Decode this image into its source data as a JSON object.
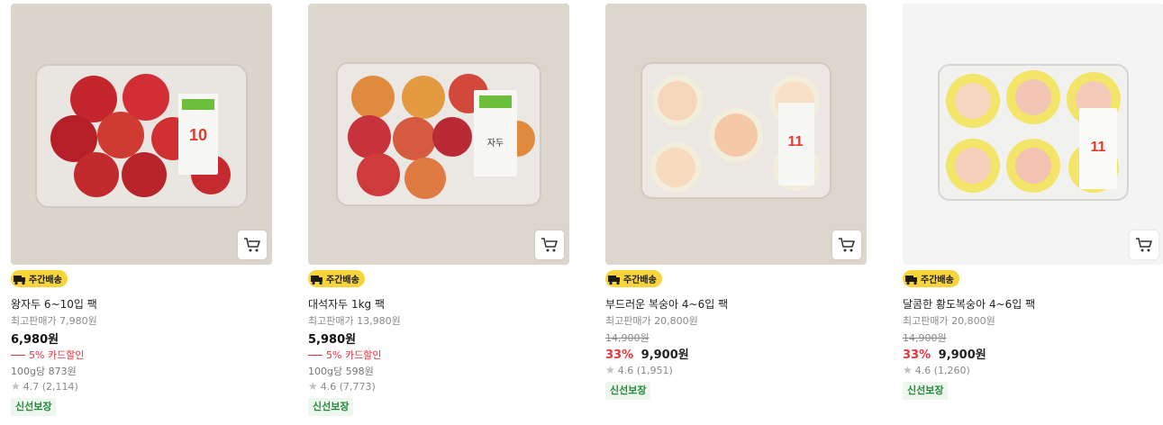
{
  "colors": {
    "badge_bg": "#f6d43a",
    "discount_red": "#e8323c",
    "fresh_green": "#1f8a3a"
  },
  "products": [
    {
      "badge": "주간배송",
      "title": "왕자두 6~10입 팩",
      "max_price": "최고판매가 7,980원",
      "price": "6,980원",
      "card_discount": "5% 카드할인",
      "unit_price": "100g당 873원",
      "rating": "4.7 (2,114)",
      "tag": "신선보장",
      "photo_subject": "plum-pack-image",
      "label_big": "10"
    },
    {
      "badge": "주간배송",
      "title": "대석자두 1kg 팩",
      "max_price": "최고판매가 13,980원",
      "price": "5,980원",
      "card_discount": "5% 카드할인",
      "unit_price": "100g당 598원",
      "rating": "4.6 (7,773)",
      "tag": "신선보장",
      "photo_subject": "daeseok-plum-pack-image",
      "label_big": "자두"
    },
    {
      "badge": "주간배송",
      "title": "부드러운 복숭아 4~6입 팩",
      "max_price": "최고판매가 20,800원",
      "original_price": "14,900원",
      "discount_pct": "33%",
      "price": "9,900원",
      "rating": "4.6 (1,951)",
      "tag": "신선보장",
      "photo_subject": "soft-peach-pack-image",
      "label_big": "11"
    },
    {
      "badge": "주간배송",
      "title": "달콤한 황도복숭아 4~6입 팩",
      "max_price": "최고판매가 20,800원",
      "original_price": "14,900원",
      "discount_pct": "33%",
      "price": "9,900원",
      "rating": "4.6 (1,260)",
      "tag": "신선보장",
      "photo_subject": "yellow-peach-pack-image",
      "label_big": "11"
    }
  ]
}
